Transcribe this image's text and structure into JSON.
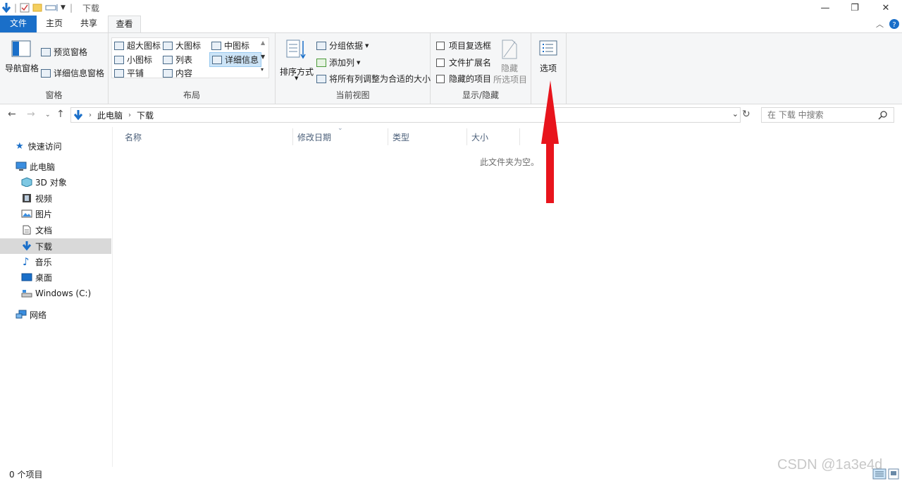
{
  "window": {
    "title": "下载",
    "minimize_glyph": "—",
    "restore_glyph": "❐",
    "close_glyph": "✕"
  },
  "ribbon_tabs": [
    "文件",
    "主页",
    "共享",
    "查看"
  ],
  "ribbon": {
    "panes": {
      "label": "窗格",
      "nav_pane": "导航窗格",
      "preview_pane": "预览窗格",
      "details_pane": "详细信息窗格"
    },
    "layout": {
      "label": "布局",
      "extra_large": "超大图标",
      "large": "大图标",
      "medium": "中图标",
      "small": "小图标",
      "list": "列表",
      "details": "详细信息",
      "tiles": "平铺",
      "content": "内容"
    },
    "current_view": {
      "label": "当前视图",
      "sort_by": "排序方式",
      "group_by": "分组依据",
      "add_columns": "添加列",
      "size_all_columns": "将所有列调整为合适的大小"
    },
    "show_hide": {
      "label": "显示/隐藏",
      "item_checkboxes": "项目复选框",
      "file_extensions": "文件扩展名",
      "hidden_items": "隐藏的项目",
      "hide": "隐藏",
      "selected_items": "所选项目"
    },
    "options": "选项"
  },
  "address": {
    "segments": [
      "此电脑",
      "下载"
    ],
    "search_placeholder": "在 下载 中搜索"
  },
  "sidebar": {
    "items": [
      {
        "label": "快速访问",
        "icon": "star-icon"
      },
      {
        "label": "此电脑",
        "icon": "computer-icon"
      },
      {
        "label": "3D 对象",
        "icon": "cube-icon"
      },
      {
        "label": "视频",
        "icon": "film-icon"
      },
      {
        "label": "图片",
        "icon": "picture-icon"
      },
      {
        "label": "文档",
        "icon": "document-icon"
      },
      {
        "label": "下载",
        "icon": "download-icon"
      },
      {
        "label": "音乐",
        "icon": "music-icon"
      },
      {
        "label": "桌面",
        "icon": "desktop-icon"
      },
      {
        "label": "Windows (C:)",
        "icon": "drive-icon"
      },
      {
        "label": "网络",
        "icon": "network-icon"
      }
    ]
  },
  "columns": [
    "名称",
    "修改日期",
    "类型",
    "大小"
  ],
  "empty_message": "此文件夹为空。",
  "status": "0 个项目",
  "watermark": "CSDN @1a3e4d",
  "colors": {
    "accent": "#1a6fc9",
    "arrow": "#e8141c"
  }
}
